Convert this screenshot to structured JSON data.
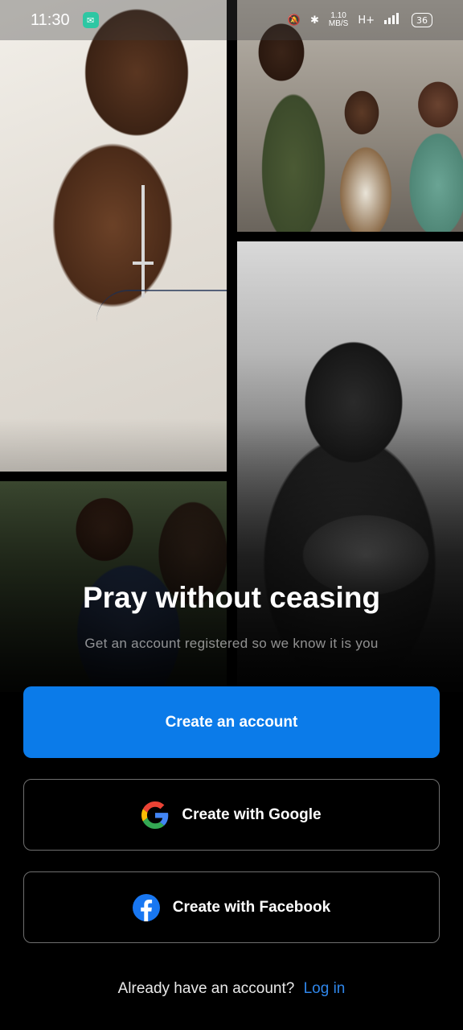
{
  "status_bar": {
    "time": "11:30",
    "net_speed_value": "1.10",
    "net_speed_unit": "MB/S",
    "network_type": "H+",
    "battery": "36"
  },
  "onboarding": {
    "headline": "Pray without ceasing",
    "subtitle": "Get an account registered so we know it is you",
    "create_account_label": "Create an account",
    "google_label": "Create with Google",
    "facebook_label": "Create with Facebook",
    "login_prompt": "Already have an account?",
    "login_link": "Log in"
  },
  "colors": {
    "primary": "#0b7be9",
    "link": "#2f86ea",
    "background": "#000000",
    "facebook": "#1877f2"
  },
  "icons": [
    "chat-notification-icon",
    "mute-icon",
    "bluetooth-icon",
    "signal-icon",
    "battery-icon",
    "google-icon",
    "facebook-icon"
  ]
}
